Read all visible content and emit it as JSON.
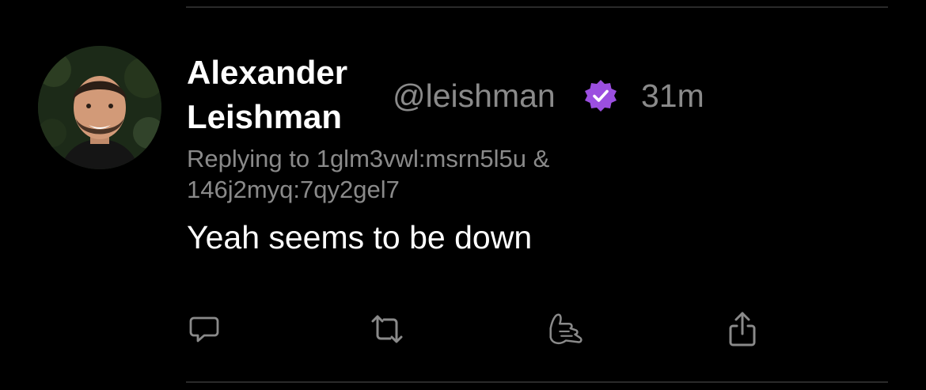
{
  "post": {
    "author_name": "Alexander Leishman",
    "handle": "@leishman",
    "timestamp": "31m",
    "replying_to": "Replying to 1glm3vwl:msrn5l5u & 146j2myq:7qy2gel7",
    "text": "Yeah seems to be down"
  },
  "icons": {
    "verified": "verified-badge-icon",
    "reply": "reply-icon",
    "repost": "repost-icon",
    "like": "shaka-like-icon",
    "share": "share-icon"
  },
  "colors": {
    "background": "#000000",
    "primary_text": "#ffffff",
    "secondary_text": "#8a8a8a",
    "verified_badge": "#9b4fe0",
    "divider": "#2a2a2a"
  }
}
